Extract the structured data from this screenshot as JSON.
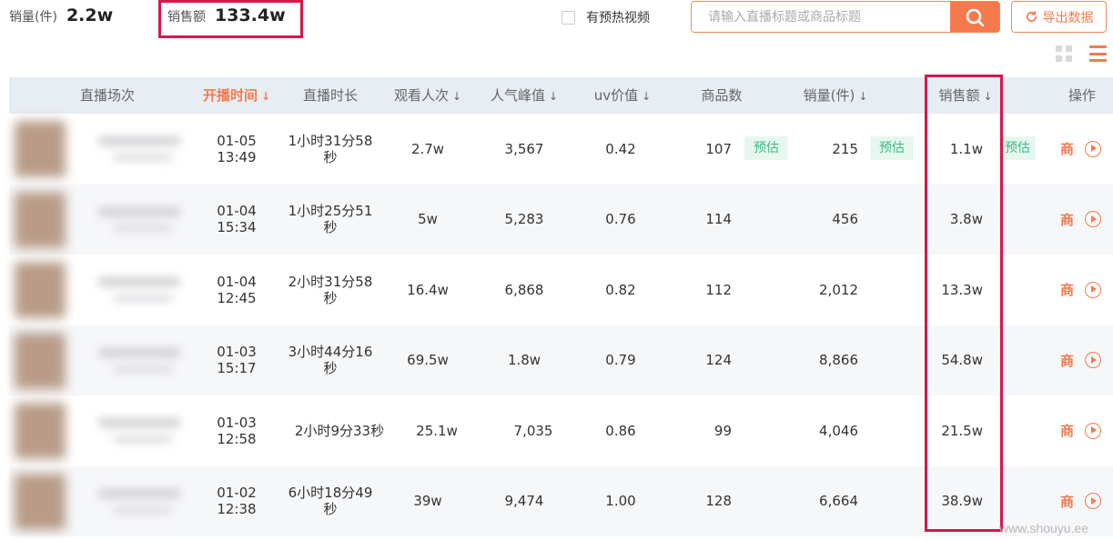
{
  "summary": {
    "qty_label": "销量(件)",
    "qty_value": "2.2w",
    "sales_label": "销售额",
    "sales_value": "133.4w"
  },
  "filters": {
    "preheat_label": "有预热视频",
    "preheat_checked": false,
    "search_placeholder": "请输入直播标题或商品标题",
    "search_icon": "search-icon",
    "export_label": "导出数据",
    "export_icon": "refresh-icon"
  },
  "view_toggle": {
    "grid_icon": "grid-view-icon",
    "list_icon": "list-view-icon",
    "active": "list"
  },
  "table": {
    "headers": {
      "session": "直播场次",
      "start_time": "开播时间",
      "duration": "直播时长",
      "views": "观看人次",
      "peak": "人气峰值",
      "uv": "uv价值",
      "products": "商品数",
      "qty": "销量(件)",
      "sales": "销售额",
      "ops": "操作"
    },
    "sort_icon": "↓",
    "active_sort": "start_time",
    "estimate_label": "预估",
    "rows": [
      {
        "time": "01-05\n13:49",
        "duration": "1小时31分58\n秒",
        "views": "2.7w",
        "peak": "3,567",
        "uv": "0.42",
        "products": "107",
        "qty": "215",
        "sales": "1.1w"
      },
      {
        "time": "01-04\n15:34",
        "duration": "1小时25分51\n秒",
        "views": "5w",
        "peak": "5,283",
        "uv": "0.76",
        "products": "114",
        "qty": "456",
        "sales": "3.8w"
      },
      {
        "time": "01-04\n12:45",
        "duration": "2小时31分58\n秒",
        "views": "16.4w",
        "peak": "6,868",
        "uv": "0.82",
        "products": "112",
        "qty": "2,012",
        "sales": "13.3w"
      },
      {
        "time": "01-03\n15:17",
        "duration": "3小时44分16\n秒",
        "views": "69.5w",
        "peak": "1.8w",
        "uv": "0.79",
        "products": "124",
        "qty": "8,866",
        "sales": "54.8w"
      },
      {
        "time": "01-03\n12:58",
        "duration": "2小时9分33秒",
        "views": "25.1w",
        "peak": "7,035",
        "uv": "0.86",
        "products": "99",
        "qty": "4,046",
        "sales": "21.5w"
      },
      {
        "time": "01-02\n12:38",
        "duration": "6小时18分49\n秒",
        "views": "39w",
        "peak": "9,474",
        "uv": "1.00",
        "products": "128",
        "qty": "6,664",
        "sales": "38.9w"
      }
    ],
    "op_icons": [
      "detail-icon",
      "play-icon"
    ],
    "op_detail_glyph": "商"
  },
  "watermark": "www.shouyu.ee",
  "colors": {
    "accent": "#f47a4d",
    "highlight": "#d6174c",
    "estimate_text": "#3fb98a",
    "estimate_bg": "#e6f7f0",
    "header_bg": "#e8ecf3"
  }
}
